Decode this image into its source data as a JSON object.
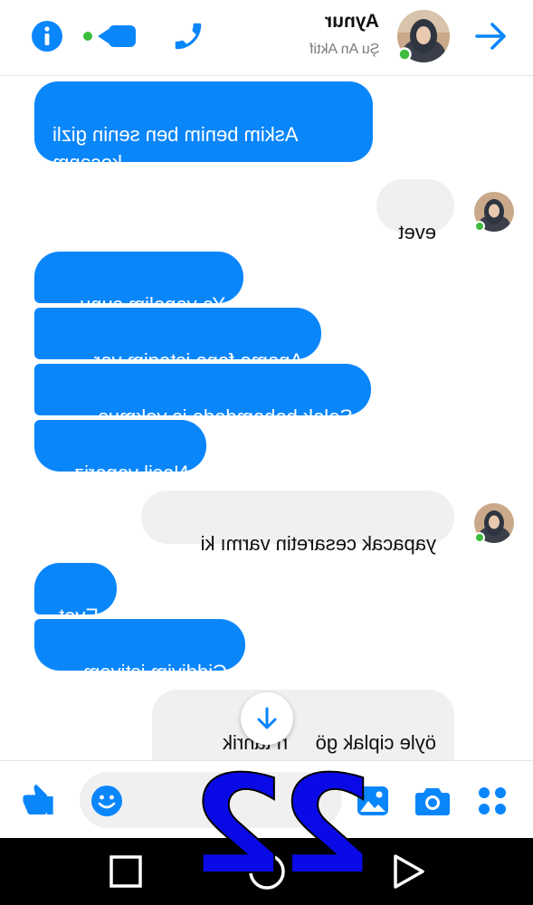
{
  "header": {
    "contact_name": "Aynur",
    "status": "Şu An Aktif",
    "icons": [
      "arrow-right-icon",
      "avatar",
      "phone-icon",
      "video-camera-icon",
      "info-icon"
    ]
  },
  "messages": [
    {
      "side": "sent",
      "text": "Askim benim ben senin gizli\nkocanm"
    },
    {
      "side": "received",
      "text": "evet"
    },
    {
      "side": "sent",
      "text": "Ya yapalim sunu"
    },
    {
      "side": "sent",
      "text": "Anama fena istegim var"
    },
    {
      "side": "sent",
      "text": "Salak babamdada is yokmus"
    },
    {
      "side": "sent",
      "text": "Nasil yapariz"
    },
    {
      "side": "received",
      "text": "yapacak cesaretin varmı ki"
    },
    {
      "side": "sent",
      "text": "Evet"
    },
    {
      "side": "sent",
      "text": "Ciddiyim istiyom"
    },
    {
      "side": "received",
      "text": "öyle ciplak gö     n tahrik\noluyorsun da"
    }
  ],
  "overlay": {
    "number": "22",
    "color": "#0a0ae6"
  },
  "colors": {
    "accent": "#0a86fb",
    "online": "#3dbd3d",
    "received_bubble": "#f0f0f0"
  }
}
